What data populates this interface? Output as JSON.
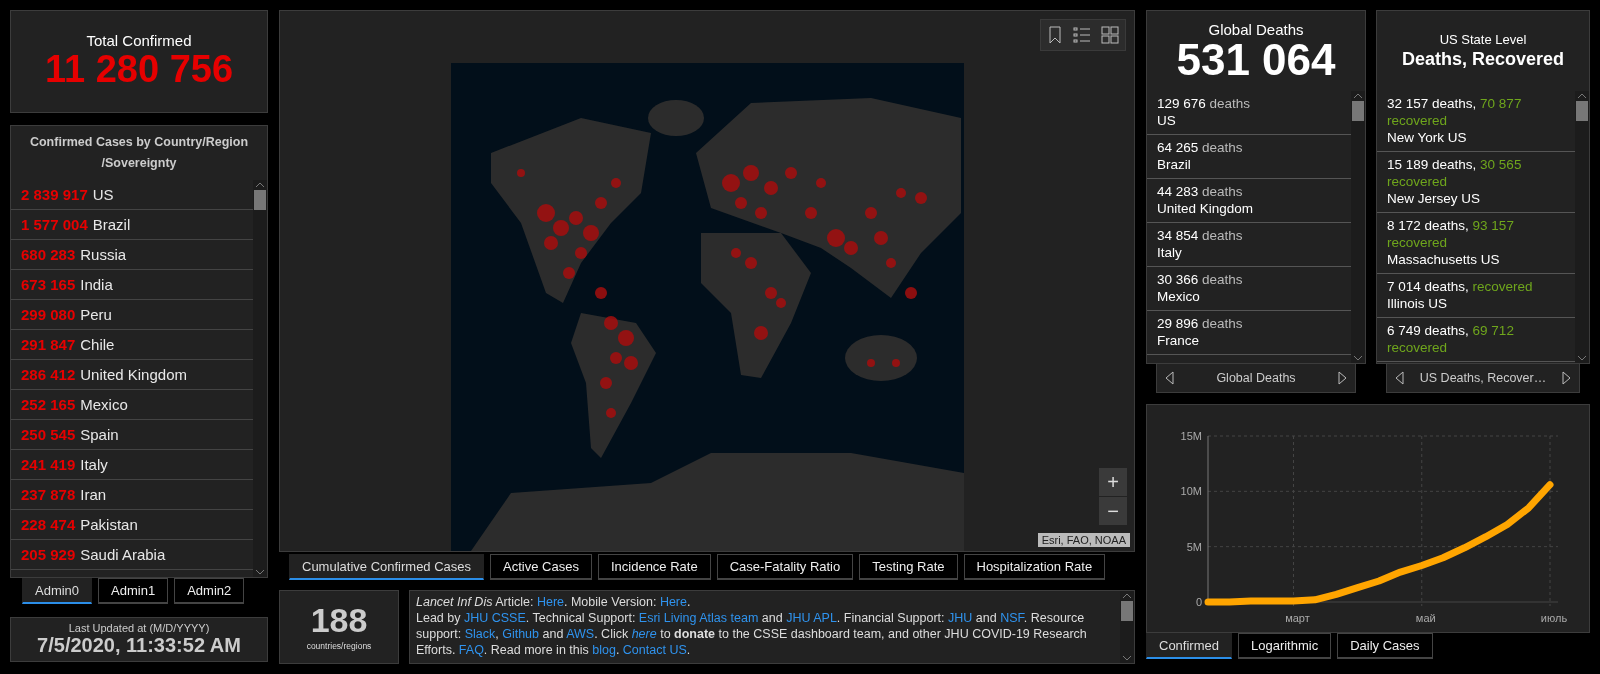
{
  "total_confirmed": {
    "title": "Total Confirmed",
    "value": "11 280 756"
  },
  "country_list": {
    "title_lines": [
      "Confirmed Cases by Country/Region",
      "/Sovereignty"
    ],
    "rows": [
      {
        "value": "2 839 917",
        "name": "US"
      },
      {
        "value": "1 577 004",
        "name": "Brazil"
      },
      {
        "value": "680 283",
        "name": "Russia"
      },
      {
        "value": "673 165",
        "name": "India"
      },
      {
        "value": "299 080",
        "name": "Peru"
      },
      {
        "value": "291 847",
        "name": "Chile"
      },
      {
        "value": "286 412",
        "name": "United Kingdom"
      },
      {
        "value": "252 165",
        "name": "Mexico"
      },
      {
        "value": "250 545",
        "name": "Spain"
      },
      {
        "value": "241 419",
        "name": "Italy"
      },
      {
        "value": "237 878",
        "name": "Iran"
      },
      {
        "value": "228 474",
        "name": "Pakistan"
      },
      {
        "value": "205 929",
        "name": "Saudi Arabia"
      }
    ]
  },
  "admin_tabs": [
    {
      "label": "Admin0",
      "selected": true
    },
    {
      "label": "Admin1",
      "selected": false
    },
    {
      "label": "Admin2",
      "selected": false
    }
  ],
  "last_updated": {
    "label": "Last Updated at (M/D/YYYY)",
    "value": "7/5/2020, 11:33:52 AM"
  },
  "map": {
    "zoom_in": "+",
    "zoom_out": "−",
    "attribution": "Esri, FAO, NOAA",
    "tabs": [
      {
        "label": "Cumulative Confirmed Cases",
        "selected": true
      },
      {
        "label": "Active Cases",
        "selected": false
      },
      {
        "label": "Incidence Rate",
        "selected": false
      },
      {
        "label": "Case-Fatality Ratio",
        "selected": false
      },
      {
        "label": "Testing Rate",
        "selected": false
      },
      {
        "label": "Hospitalization Rate",
        "selected": false
      }
    ]
  },
  "counter": {
    "value": "188",
    "label": "countries/regions"
  },
  "info": {
    "paragraphs": [
      [
        {
          "kind": "text",
          "text": "*Lancet Inf Dis* Article: "
        },
        {
          "kind": "link",
          "text": "Here"
        },
        {
          "kind": "text",
          "text": ". Mobile Version: "
        },
        {
          "kind": "link",
          "text": "Here"
        },
        {
          "kind": "text",
          "text": "."
        }
      ],
      [
        {
          "kind": "text",
          "text": "Lead by "
        },
        {
          "kind": "link",
          "text": "JHU CSSE"
        },
        {
          "kind": "text",
          "text": ". Technical Support: "
        },
        {
          "kind": "link",
          "text": "Esri Living Atlas team"
        },
        {
          "kind": "text",
          "text": " and "
        },
        {
          "kind": "link",
          "text": "JHU APL"
        },
        {
          "kind": "text",
          "text": ". Financial Support: "
        },
        {
          "kind": "link",
          "text": "JHU"
        },
        {
          "kind": "text",
          "text": " and "
        },
        {
          "kind": "link",
          "text": "NSF"
        },
        {
          "kind": "text",
          "text": ". Resource support: "
        },
        {
          "kind": "link",
          "text": "Slack"
        },
        {
          "kind": "text",
          "text": ", "
        },
        {
          "kind": "link",
          "text": "Github"
        },
        {
          "kind": "text",
          "text": " and "
        },
        {
          "kind": "link",
          "text": "AWS"
        },
        {
          "kind": "text",
          "text": ". Click "
        },
        {
          "kind": "link",
          "text": "*here*"
        },
        {
          "kind": "text",
          "text": " to **donate** to the CSSE dashboard team, and other JHU COVID-19 Research Efforts. "
        },
        {
          "kind": "link",
          "text": "FAQ"
        },
        {
          "kind": "text",
          "text": ". Read more in this "
        },
        {
          "kind": "link",
          "text": "blog"
        },
        {
          "kind": "text",
          "text": ". "
        },
        {
          "kind": "link",
          "text": "Contact US"
        },
        {
          "kind": "text",
          "text": "."
        }
      ]
    ]
  },
  "global_deaths": {
    "title": "Global Deaths",
    "value": "531 064",
    "nav_label": "Global Deaths",
    "rows": [
      {
        "value": "129 676",
        "unit": "deaths",
        "name": "US"
      },
      {
        "value": "64 265",
        "unit": "deaths",
        "name": "Brazil"
      },
      {
        "value": "44 283",
        "unit": "deaths",
        "name": "United Kingdom"
      },
      {
        "value": "34 854",
        "unit": "deaths",
        "name": "Italy"
      },
      {
        "value": "30 366",
        "unit": "deaths",
        "name": "Mexico"
      },
      {
        "value": "29 896",
        "unit": "deaths",
        "name": "France"
      }
    ]
  },
  "us_state": {
    "subtitle": "US State Level",
    "title": "Deaths, Recovered",
    "nav_label": "US Deaths, Recover…",
    "rows": [
      {
        "deaths": "32 157 deaths,",
        "recovered": "70 877",
        "recovered_label": "recovered",
        "name": "New York US"
      },
      {
        "deaths": "15 189 deaths,",
        "recovered": "30 565",
        "recovered_label": "recovered",
        "name": "New Jersey US"
      },
      {
        "deaths": "8 172 deaths,",
        "recovered": "93 157",
        "recovered_label": "recovered",
        "name": "Massachusetts US"
      },
      {
        "deaths": "7 014 deaths,",
        "recovered_label": "recovered",
        "name": "Illinois US"
      },
      {
        "deaths": "6 749 deaths,",
        "recovered": "69 712",
        "recovered_label": "recovered"
      }
    ]
  },
  "chart": {
    "tabs": [
      {
        "label": "Confirmed",
        "selected": true
      },
      {
        "label": "Logarithmic",
        "selected": false
      },
      {
        "label": "Daily Cases",
        "selected": false
      }
    ],
    "chart_data": {
      "type": "line",
      "categories": [
        null,
        null,
        null,
        null,
        "март",
        null,
        null,
        null,
        null,
        null,
        "май",
        null,
        null,
        null,
        null,
        null,
        "июль"
      ],
      "series": [
        {
          "color": "#ffa500",
          "values": [
            0,
            0,
            100000,
            100000,
            100000,
            200000,
            700000,
            1300000,
            1900000,
            2700000,
            3300000,
            4000000,
            4900000,
            5900000,
            7000000,
            8500000,
            10600000
          ]
        }
      ],
      "ylim": [
        0,
        15000000
      ],
      "yticks": [
        {
          "value": 0,
          "label": "0"
        },
        {
          "value": 5000000,
          "label": "5M"
        },
        {
          "value": 10000000,
          "label": "10M"
        },
        {
          "value": 15000000,
          "label": "15M"
        }
      ]
    }
  }
}
